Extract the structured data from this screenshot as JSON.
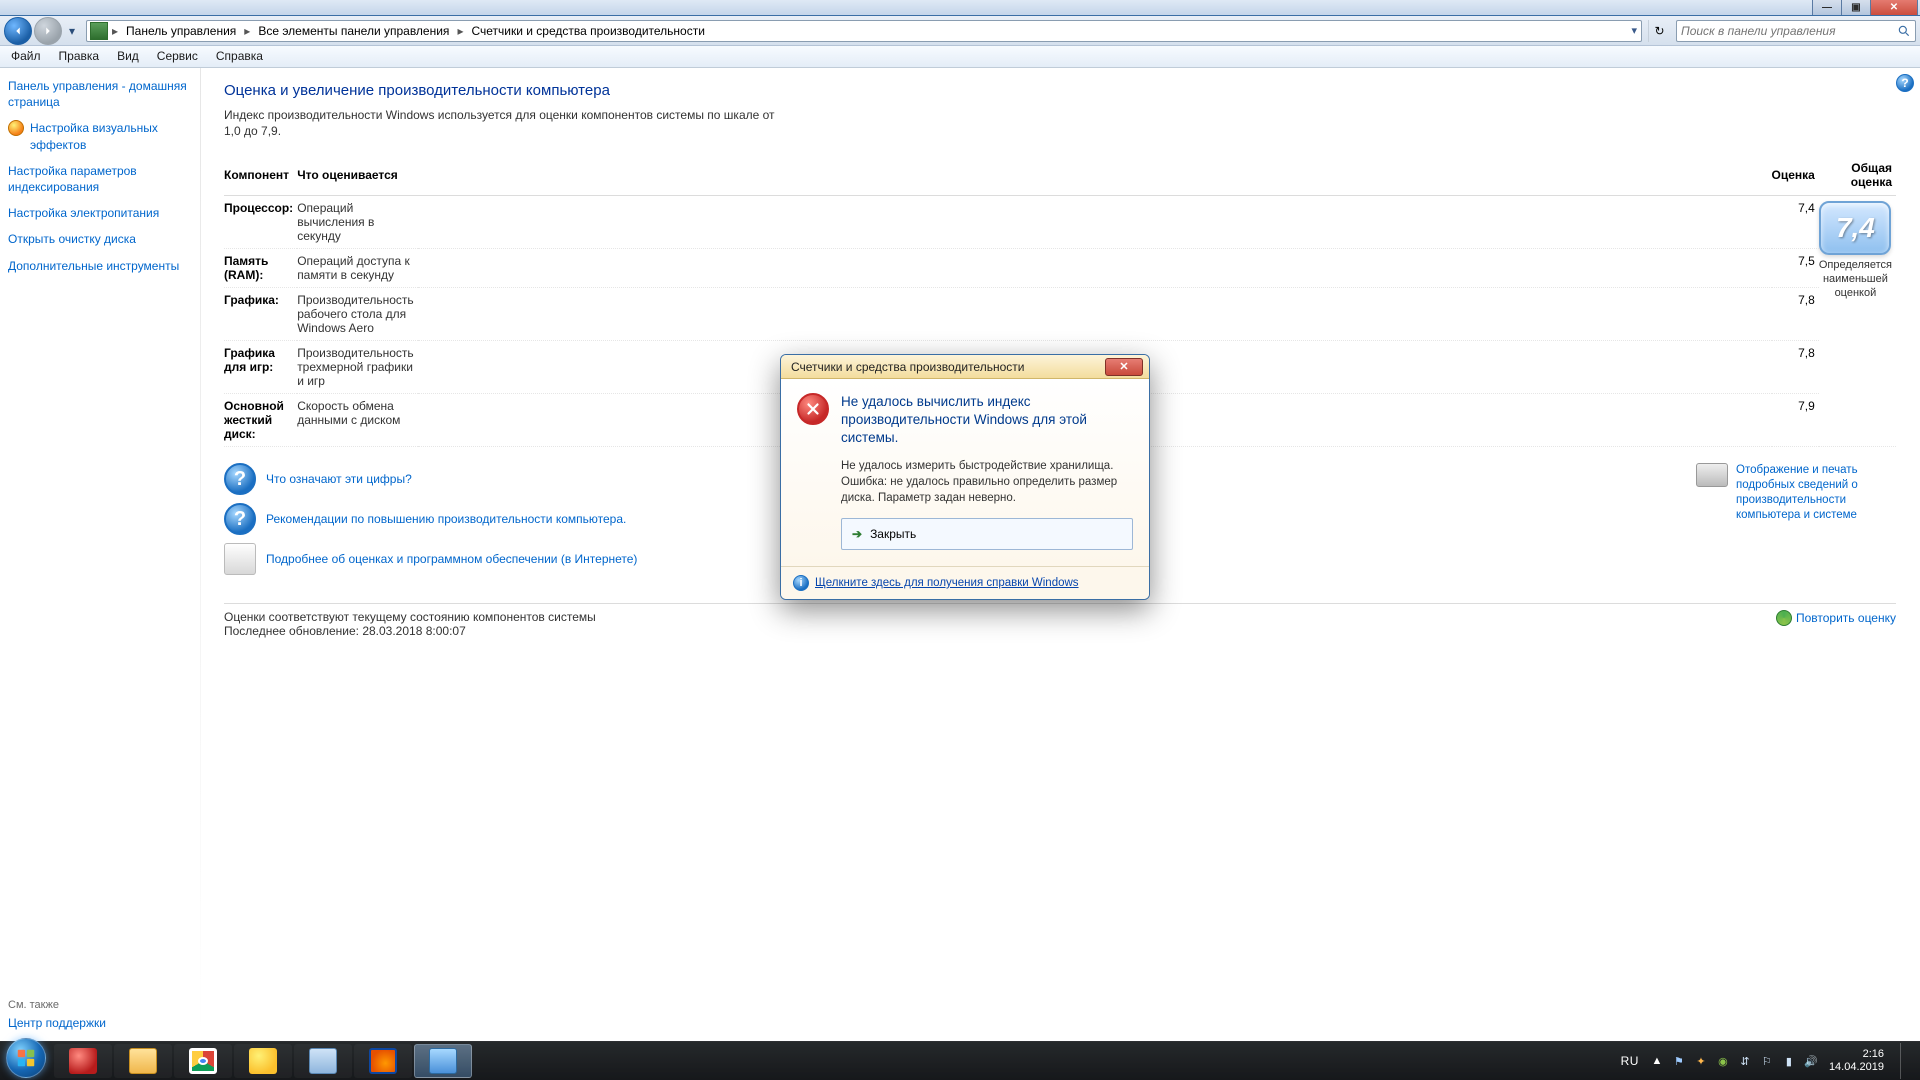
{
  "window": {
    "buttons": {
      "min": "—",
      "max": "▣",
      "close": "✕"
    }
  },
  "nav": {
    "segments": [
      "Панель управления",
      "Все элементы панели управления",
      "Счетчики и средства производительности"
    ],
    "dropdown_hint": "▾",
    "refresh_hint": "↻"
  },
  "search": {
    "placeholder": "Поиск в панели управления"
  },
  "menu": [
    "Файл",
    "Правка",
    "Вид",
    "Сервис",
    "Справка"
  ],
  "sidebar": {
    "items": [
      {
        "label": "Панель управления - домашняя страница",
        "icon": false
      },
      {
        "label": "Настройка визуальных эффектов",
        "icon": true
      },
      {
        "label": "Настройка параметров индексирования",
        "icon": false
      },
      {
        "label": "Настройка электропитания",
        "icon": false
      },
      {
        "label": "Открыть очистку диска",
        "icon": false
      },
      {
        "label": "Дополнительные инструменты",
        "icon": false
      }
    ],
    "see_also_heading": "См. также",
    "see_also": "Центр поддержки"
  },
  "page": {
    "title": "Оценка и увеличение производительности компьютера",
    "subtitle": "Индекс производительности Windows используется для оценки компонентов системы по шкале от 1,0 до 7,9.",
    "columns": {
      "component": "Компонент",
      "desc": "Что оценивается",
      "score": "Оценка",
      "base": "Общая оценка"
    },
    "rows": [
      {
        "comp": "Процессор:",
        "desc": "Операций вычисления в секунду",
        "score": "7,4"
      },
      {
        "comp": "Память (RAM):",
        "desc": "Операций доступа к памяти в секунду",
        "score": "7,5"
      },
      {
        "comp": "Графика:",
        "desc": "Производительность рабочего стола для Windows Aero",
        "score": "7,8"
      },
      {
        "comp": "Графика для игр:",
        "desc": "Производительность трехмерной графики и игр",
        "score": "7,8"
      },
      {
        "comp": "Основной жесткий диск:",
        "desc": "Скорость обмена данными с диском",
        "score": "7,9"
      }
    ],
    "base_score": "7,4",
    "base_caption": "Определяется наименьшей оценкой",
    "links": {
      "what": "Что означают эти цифры?",
      "rec": "Рекомендации по повышению производительности компьютера.",
      "more": "Подробнее об оценках и программном обеспечении (в Интернете)",
      "print": "Отображение и печать подробных сведений о производительности компьютера и системе"
    },
    "footer_line1": "Оценки соответствуют текущему состоянию компонентов системы",
    "footer_line2": "Последнее обновление: 28.03.2018 8:00:07",
    "rerun": "Повторить оценку"
  },
  "modal": {
    "title": "Счетчики и средства производительности",
    "heading": "Не удалось вычислить индекс производительности Windows для этой системы.",
    "message": "Не удалось измерить быстродействие хранилища. Ошибка: не удалось правильно определить размер диска. Параметр задан неверно.",
    "action": "Закрыть",
    "help": "Щелкните здесь для получения справки Windows "
  },
  "tray": {
    "lang": "RU",
    "up": "▲",
    "time": "2:16",
    "date": "14.04.2019"
  }
}
